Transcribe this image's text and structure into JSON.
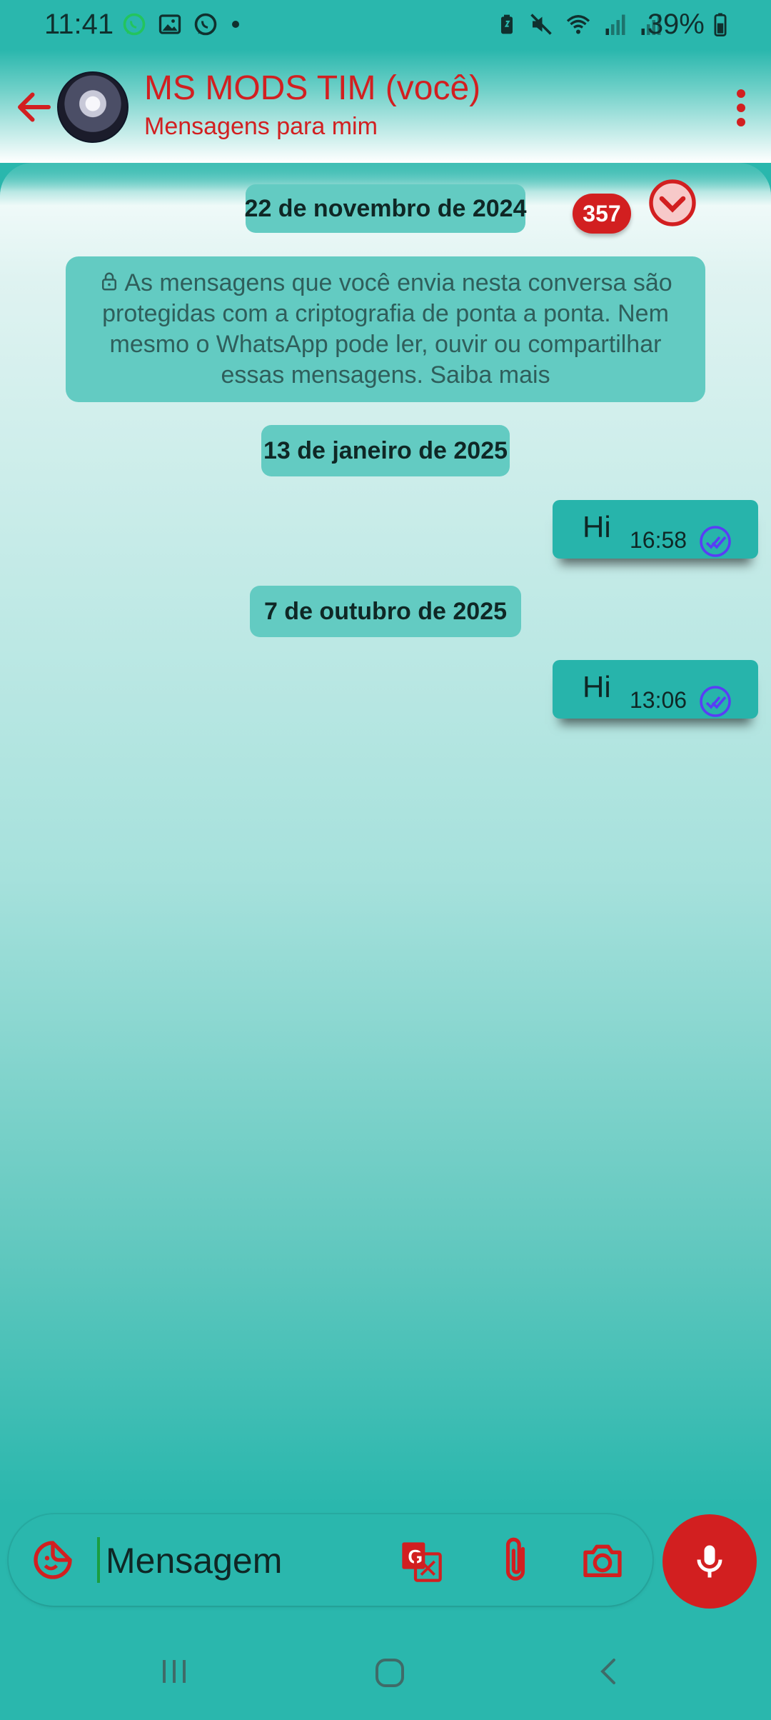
{
  "status_bar": {
    "time": "11:41",
    "battery_percent": "39%",
    "icons": [
      "whatsapp-green-icon",
      "gallery-icon",
      "whatsapp-icon",
      "dot",
      "battery-saver-icon",
      "mute-icon",
      "wifi-icon",
      "signal-icon",
      "signal-icon",
      "battery-icon"
    ]
  },
  "header": {
    "title": "MS MODS TIM (você)",
    "subtitle": "Mensagens para mim",
    "back_icon": "arrow-left-icon",
    "menu_icon": "more-vert-icon"
  },
  "chat": {
    "unread_count": "357",
    "top_date": "22 de novembro de 2024",
    "encryption_notice": "As mensagens que você envia nesta conversa são protegidas com a criptografia de ponta a ponta. Nem mesmo o WhatsApp pode ler, ouvir ou compartilhar essas mensagens. Saiba mais",
    "groups": [
      {
        "date": "13 de janeiro de 2025",
        "messages": [
          {
            "text": "Hi",
            "time": "16:58",
            "status": "read"
          }
        ]
      },
      {
        "date": "7 de outubro de 2025",
        "messages": [
          {
            "text": "Hi",
            "time": "13:06",
            "status": "read"
          }
        ]
      }
    ]
  },
  "composer": {
    "placeholder": "Mensagem",
    "icons": [
      "sticker-icon",
      "translate-icon",
      "attach-icon",
      "camera-icon",
      "mic-icon"
    ]
  },
  "colors": {
    "teal": "#2ab7ad",
    "chip": "#63cbc2",
    "accent_red": "#d21f20",
    "read_check": "#5a3df5"
  }
}
